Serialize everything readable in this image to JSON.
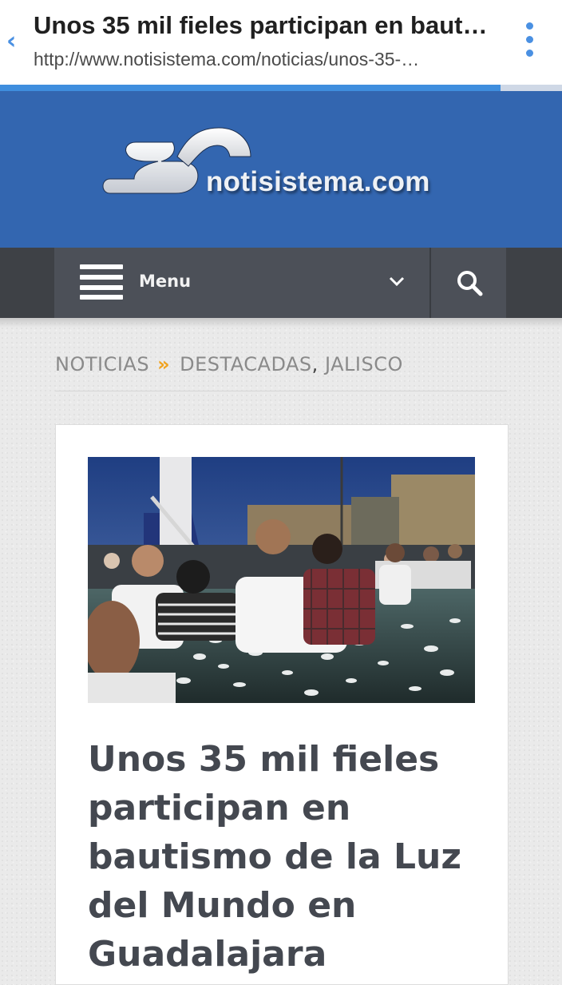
{
  "browser": {
    "page_title": "Unos 35 mil fieles participan en baut…",
    "url": "http://www.notisistema.com/noticias/unos-35-…",
    "load_progress": 0.89,
    "accent_color": "#4a90e2",
    "icons": {
      "back": "chevron-left-icon",
      "menu": "vertical-dots-icon"
    }
  },
  "site": {
    "brand": "notisistema.com",
    "header_color": "#3366b0"
  },
  "nav": {
    "menu_label": "Menu",
    "icons": {
      "menu": "hamburger-icon",
      "expand": "chevron-down-icon",
      "search": "search-icon"
    }
  },
  "breadcrumb": {
    "root": "NOTICIAS",
    "separator": "»",
    "category_1": "DESTACADAS",
    "comma": ",",
    "category_2": "JALISCO",
    "separator_color": "#f0a31f"
  },
  "article": {
    "photo_subject": "photo",
    "headline": "Unos 35 mil fieles participan en bautismo de la Luz del Mundo en Guadalajara"
  }
}
